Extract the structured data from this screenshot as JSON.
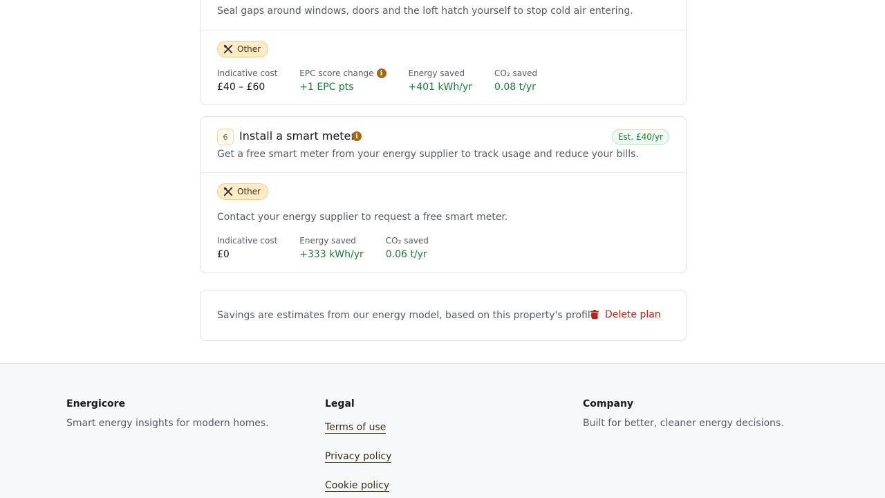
{
  "recommendations": [
    {
      "description": "Seal gaps around windows, doors and the loft hatch yourself to stop cold air entering.",
      "category": "Other",
      "metrics": [
        {
          "label": "Indicative cost",
          "value": "£40 – £60",
          "green": false,
          "info": false
        },
        {
          "label": "EPC score change",
          "value": "+1 EPC pts",
          "green": true,
          "info": true
        },
        {
          "label": "Energy saved",
          "value": "+401 kWh/yr",
          "green": true,
          "info": false
        },
        {
          "label": "CO₂ saved",
          "value": "0.08 t/yr",
          "green": true,
          "info": false
        }
      ]
    },
    {
      "number": "6",
      "title": "Install a smart meter",
      "estimate": "Est. £40/yr",
      "description": "Get a free smart meter from your energy supplier to track usage and reduce your bills.",
      "category": "Other",
      "note": "Contact your energy supplier to request a free smart meter.",
      "metrics": [
        {
          "label": "Indicative cost",
          "value": "£0",
          "green": false,
          "info": false
        },
        {
          "label": "Energy saved",
          "value": "+333 kWh/yr",
          "green": true,
          "info": false
        },
        {
          "label": "CO₂ saved",
          "value": "0.06 t/yr",
          "green": true,
          "info": false
        }
      ]
    }
  ],
  "plan_footer": {
    "note": "Savings are estimates from our energy model, based on this property's profile.",
    "delete_label": "Delete plan"
  },
  "site_footer": {
    "brand": {
      "heading": "Energicore",
      "text": "Smart energy insights for modern homes."
    },
    "legal": {
      "heading": "Legal",
      "links": [
        "Terms of use",
        "Privacy policy",
        "Cookie policy"
      ]
    },
    "company": {
      "heading": "Company",
      "text": "Built for better, cleaner energy decisions."
    }
  },
  "colors": {
    "accent_green": "#1c7c3a",
    "category_bg": "#fdebc8",
    "danger": "#b42318",
    "info": "#a46a12"
  },
  "icons": {
    "category": "tools-icon",
    "info": "info-icon",
    "delete": "trash-icon"
  }
}
